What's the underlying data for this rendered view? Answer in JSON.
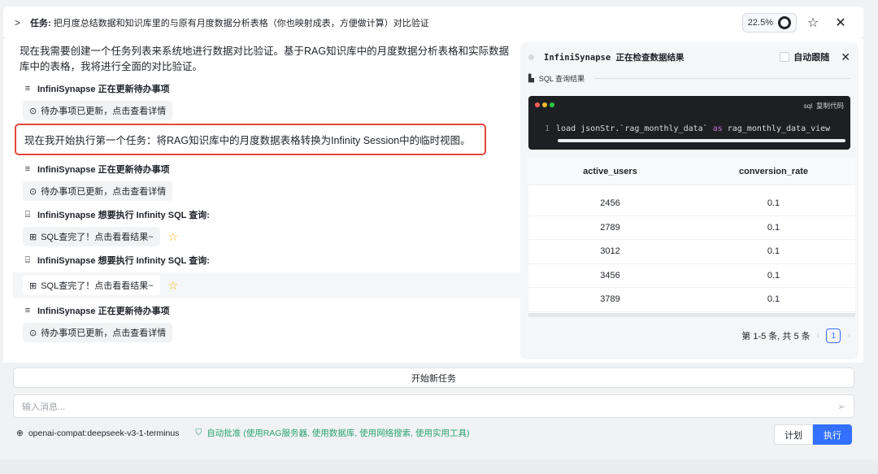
{
  "task": {
    "prefix": "任务:",
    "text": "把月度总结数据和知识库里的与原有月度数据分析表格（你也映射成表，方便做计算）对比验证",
    "progress": "22.5%"
  },
  "chat": {
    "intro": "现在我需要创建一个任务列表来系统地进行数据对比验证。基于RAG知识库中的月度数据分析表格和实际数据库中的表格，我将进行全面的对比验证。",
    "update1": "InfiniSynapse 正在更新待办事项",
    "todo1": "待办事项已更新，点击查看详情",
    "highlight": "现在我开始执行第一个任务：将RAG知识库中的月度数据表格转换为Infinity Session中的临时视图。",
    "update2": "InfiniSynapse 正在更新待办事项",
    "todo2": "待办事项已更新，点击查看详情",
    "sql1": "InfiniSynapse 想要执行 Infinity SQL 查询:",
    "sqlres1": "SQL查完了！点击看看结果~",
    "sql2": "InfiniSynapse 想要执行 Infinity SQL 查询:",
    "sqlres2": "SQL查完了！点击看看结果~",
    "update3": "InfiniSynapse 正在更新待办事项",
    "todo3": "待办事项已更新，点击查看详情"
  },
  "panel": {
    "title_name": "InfiniSynapse",
    "title_rest": "正在检查数据结果",
    "follow": "自动跟随",
    "sql_label": "SQL 查询结果",
    "code_lang": "sql",
    "copy": "复制代码",
    "line_no": "1",
    "code_a": "load jsonStr.`rag_monthly_data` ",
    "code_kw": "as",
    "code_b": " rag_monthly_data_view",
    "columns": [
      "active_users",
      "conversion_rate"
    ],
    "rows": [
      [
        "2456",
        "0.1"
      ],
      [
        "2789",
        "0.1"
      ],
      [
        "3012",
        "0.1"
      ],
      [
        "3456",
        "0.1"
      ],
      [
        "3789",
        "0.1"
      ]
    ],
    "pager_text": "第 1-5 条, 共 5 条",
    "page": "1"
  },
  "composer": {
    "new_task": "开始新任务",
    "placeholder": "输入消息...",
    "model": "openai-compat:deepseek-v3-1-terminus",
    "auto": "自动批准 (使用RAG服务器, 使用数据库, 使用网络搜索, 使用实用工具)",
    "plan": "计划",
    "run": "执行"
  },
  "colors": {
    "accent": "#3370ff",
    "highlight_border": "#e5483e",
    "auto_green": "#2ba471"
  }
}
